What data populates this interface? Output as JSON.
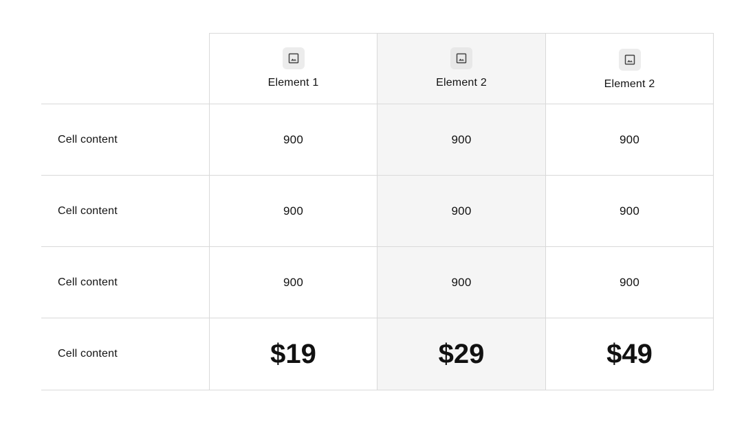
{
  "header": {
    "columns": [
      {
        "icon": "image-icon",
        "label": "Element 1"
      },
      {
        "icon": "image-icon",
        "label": "Element 2"
      },
      {
        "icon": "image-icon",
        "label": "Element 2"
      }
    ]
  },
  "rows": [
    {
      "label": "Cell content",
      "values": [
        "900",
        "900",
        "900"
      ]
    },
    {
      "label": "Cell content",
      "values": [
        "900",
        "900",
        "900"
      ]
    },
    {
      "label": "Cell content",
      "values": [
        "900",
        "900",
        "900"
      ]
    },
    {
      "label": "Cell content",
      "values": [
        "$19",
        "$29",
        "$49"
      ]
    }
  ],
  "colors": {
    "highlight_column_bg": "#f5f5f5",
    "border": "#d9d9d9",
    "icon_bg": "#ececec"
  }
}
